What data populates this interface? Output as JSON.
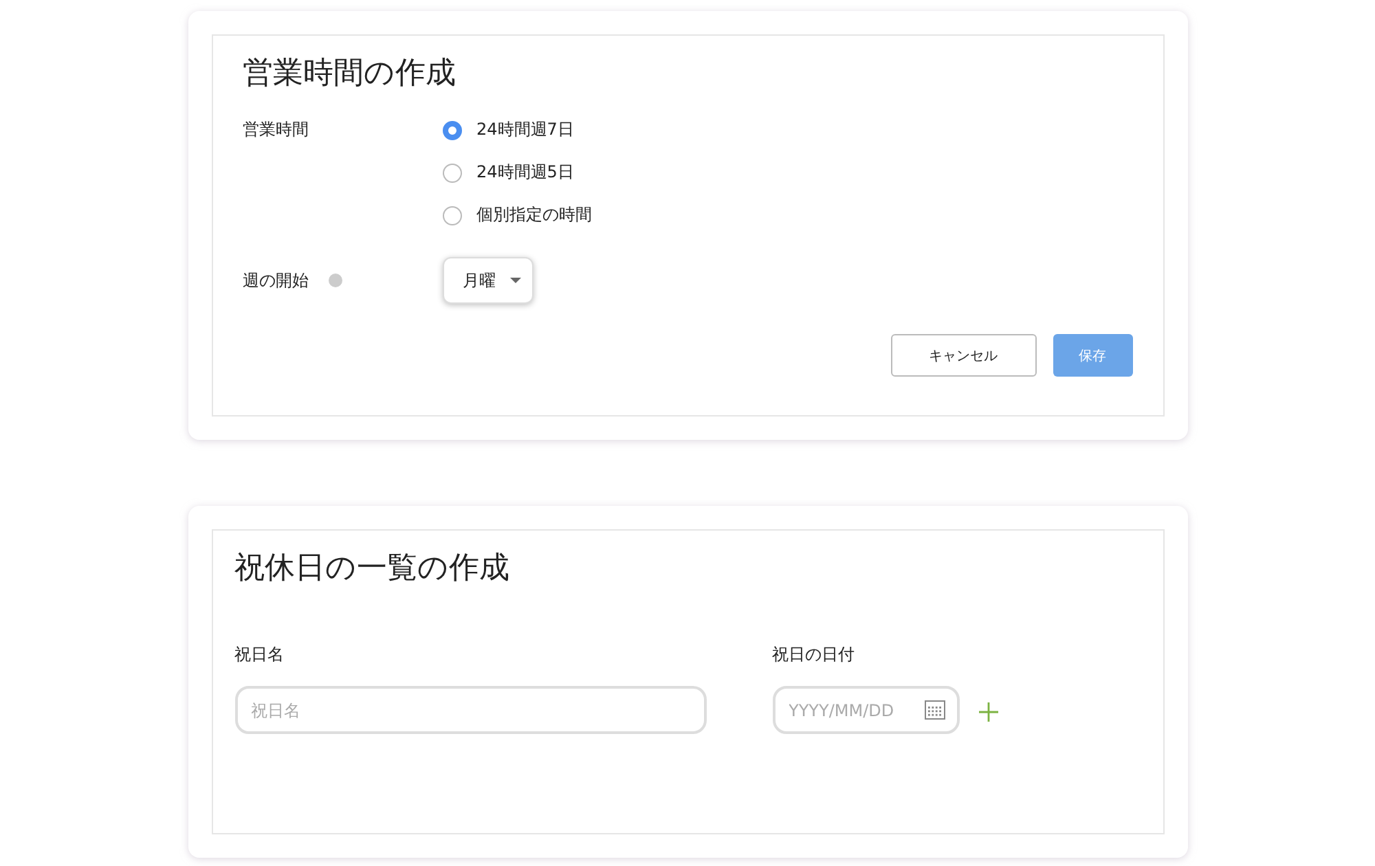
{
  "hours_card": {
    "title": "営業時間の作成",
    "hours_label": "営業時間",
    "options": [
      {
        "label": "24時間週7日",
        "selected": true
      },
      {
        "label": "24時間週5日",
        "selected": false
      },
      {
        "label": "個別指定の時間",
        "selected": false
      }
    ],
    "week_start_label": "週の開始",
    "week_start_value": "月曜",
    "buttons": [
      {
        "label": "キャンセル",
        "kind": "secondary"
      },
      {
        "label": "保存",
        "kind": "primary"
      }
    ]
  },
  "holidays_card": {
    "title": "祝休日の一覧の作成",
    "name_label": "祝日名",
    "name_placeholder": "祝日名",
    "date_label": "祝日の日付",
    "date_placeholder": "YYYY/MM/DD"
  }
}
